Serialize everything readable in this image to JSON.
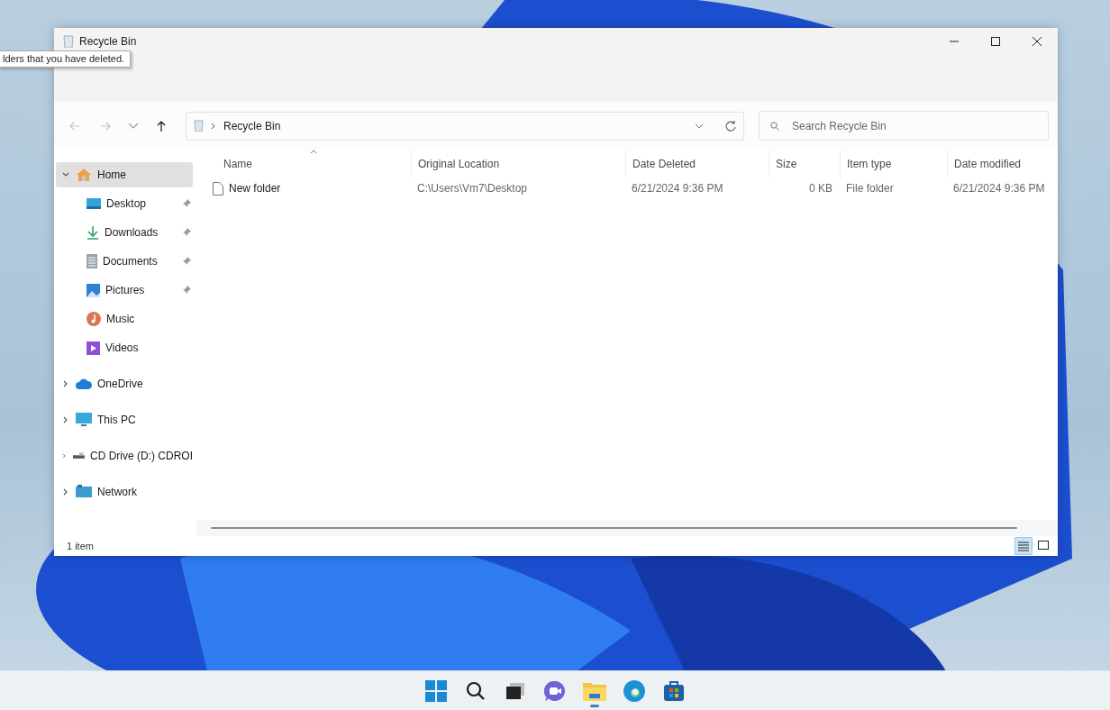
{
  "window": {
    "title": "Recycle Bin",
    "controls": [
      {
        "kind": "minimize"
      },
      {
        "kind": "maximize"
      },
      {
        "kind": "close"
      }
    ]
  },
  "tooltip": {
    "text": "lders that you have deleted."
  },
  "toolbar": {
    "nav": [
      {
        "kind": "back",
        "disabled": true
      },
      {
        "kind": "forward",
        "disabled": true
      },
      {
        "kind": "up",
        "disabled": false
      }
    ],
    "address": {
      "crumbs": [
        "Recycle Bin"
      ]
    },
    "search": {
      "placeholder": "Search Recycle Bin"
    }
  },
  "sidebar": {
    "items": [
      {
        "label": "Home",
        "kind": "home",
        "expanded": true,
        "selected": true,
        "children": [
          {
            "label": "Desktop",
            "kind": "desktop",
            "pinned": true,
            "selected": false
          },
          {
            "label": "Downloads",
            "kind": "downloads",
            "pinned": true,
            "selected": false
          },
          {
            "label": "Documents",
            "kind": "documents",
            "pinned": true,
            "selected": false
          },
          {
            "label": "Pictures",
            "kind": "pictures",
            "pinned": true,
            "selected": false
          },
          {
            "label": "Music",
            "kind": "music",
            "pinned": false,
            "selected": false
          },
          {
            "label": "Videos",
            "kind": "videos",
            "pinned": false,
            "selected": false
          }
        ]
      },
      {
        "label": "OneDrive",
        "kind": "cloud",
        "expanded": false,
        "selected": false
      },
      {
        "label": "This PC",
        "kind": "pc",
        "expanded": false,
        "selected": false
      },
      {
        "label": "CD Drive (D:) CDROI",
        "kind": "drive",
        "expanded": false,
        "selected": false
      },
      {
        "label": "Network",
        "kind": "network",
        "expanded": false,
        "selected": false
      }
    ]
  },
  "table": {
    "columns": [
      {
        "label": "Name",
        "sorted": true
      },
      {
        "label": "Original Location",
        "sorted": false
      },
      {
        "label": "Date Deleted",
        "sorted": false
      },
      {
        "label": "Size",
        "sorted": false
      },
      {
        "label": "Item type",
        "sorted": false
      },
      {
        "label": "Date modified",
        "sorted": false
      }
    ],
    "rows": [
      {
        "cells": [
          "New folder",
          "C:\\Users\\Vm7\\Desktop",
          "6/21/2024 9:36 PM",
          "0 KB",
          "File folder",
          "6/21/2024 9:36 PM"
        ]
      }
    ]
  },
  "status_bar": {
    "text": "1 item",
    "views": [
      {
        "kind": "details",
        "selected": true
      },
      {
        "kind": "tiles",
        "selected": false
      }
    ]
  },
  "taskbar": {
    "items": [
      {
        "kind": "start",
        "active": false
      },
      {
        "kind": "search",
        "active": false
      },
      {
        "kind": "taskview",
        "active": false
      },
      {
        "kind": "chat",
        "active": false
      },
      {
        "kind": "explorer",
        "active": true
      },
      {
        "kind": "edge",
        "active": false
      },
      {
        "kind": "store",
        "active": false
      }
    ]
  }
}
